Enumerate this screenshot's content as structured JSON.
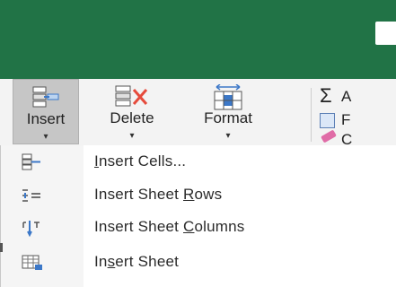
{
  "ribbon": {
    "insert_label": "Insert",
    "delete_label": "Delete",
    "format_label": "Format",
    "autosum_label": "A",
    "fill_label": "F",
    "clear_label": "C",
    "caret": "▾"
  },
  "menu": {
    "items": [
      {
        "pre": "",
        "ul": "I",
        "post": "nsert Cells...",
        "icon": "insert-cells-icon"
      },
      {
        "pre": "Insert Sheet ",
        "ul": "R",
        "post": "ows",
        "icon": "insert-sheet-rows-icon"
      },
      {
        "pre": "Insert Sheet ",
        "ul": "C",
        "post": "olumns",
        "icon": "insert-sheet-columns-icon"
      },
      {
        "pre": "In",
        "ul": "s",
        "post": "ert Sheet",
        "icon": "insert-sheet-icon"
      }
    ]
  },
  "colors": {
    "titlebar": "#217346",
    "ribbon_bg": "#f3f3f3",
    "pressed": "#c6c6c6",
    "accent_blue": "#3c78c8",
    "delete_red": "#e64b3c"
  }
}
